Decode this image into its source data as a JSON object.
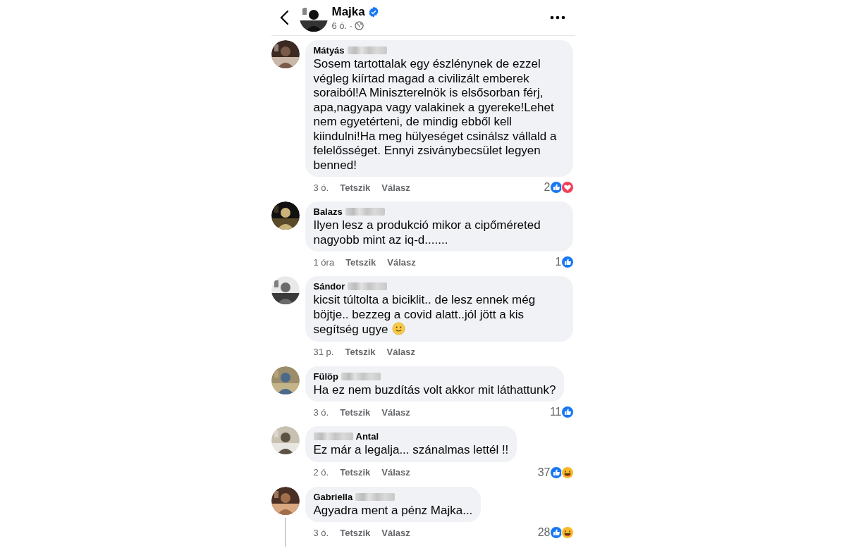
{
  "post": {
    "author": "Majka",
    "verified": true,
    "time": "6 ó. ·"
  },
  "comments": [
    {
      "name_parts": [
        {
          "kind": "name",
          "text": "Mátyás"
        },
        {
          "kind": "blurred"
        }
      ],
      "text": "Sosem tartottalak egy észlénynek de ezzel végleg kiírtad magad a civilizált emberek soraiból!A Miniszterelnök is elsősorban férj, apa,nagyapa vagy valakinek a gyereke!Lehet nem egyetérteni, de mindig ebből kell kiindulni!Ha meg hülyeséget csinálsz vállald a felelősséget. Ennyi zsiványbecsület legyen benned!",
      "time": "3 ó.",
      "like": "Tetszik",
      "reply": "Válasz",
      "count": "2",
      "reactions": [
        {
          "kind": "like"
        },
        {
          "kind": "love"
        }
      ]
    },
    {
      "name_parts": [
        {
          "kind": "name",
          "text": "Balazs"
        },
        {
          "kind": "blurred"
        }
      ],
      "text": "Ilyen lesz a produkció mikor a cipőméreted nagyobb mint az iq-d.......",
      "time": "1 óra",
      "like": "Tetszik",
      "reply": "Válasz",
      "count": "1",
      "reactions": [
        {
          "kind": "like"
        }
      ]
    },
    {
      "name_parts": [
        {
          "kind": "name",
          "text": "Sándor"
        },
        {
          "kind": "blurred"
        }
      ],
      "text": "kicsit túltolta a biciklit.. de lesz ennek még böjtje.. bezzeg a covid alatt..jól jött a kis segítség ugye",
      "smiley": true,
      "time": "31 p.",
      "like": "Tetszik",
      "reply": "Válasz"
    },
    {
      "name_parts": [
        {
          "kind": "name",
          "text": "Fülöp"
        },
        {
          "kind": "blurred"
        }
      ],
      "text": "Ha ez nem buzdítás volt akkor mit láthattunk?",
      "time": "3 ó.",
      "like": "Tetszik",
      "reply": "Válasz",
      "count": "11",
      "reactions": [
        {
          "kind": "like"
        }
      ]
    },
    {
      "name_parts": [
        {
          "kind": "blurred"
        },
        {
          "kind": "name",
          "text": "Antal"
        }
      ],
      "text": "Ez már a legalja... szánalmas lettél !!",
      "time": "2 ó.",
      "like": "Tetszik",
      "reply": "Válasz",
      "count": "37",
      "reactions": [
        {
          "kind": "like"
        },
        {
          "kind": "haha"
        }
      ]
    },
    {
      "name_parts": [
        {
          "kind": "name",
          "text": "Gabriella"
        },
        {
          "kind": "blurred"
        }
      ],
      "text": "Agyadra ment a pénz Majka...",
      "time": "3 ó.",
      "like": "Tetszik",
      "reply": "Válasz",
      "count": "28",
      "reactions": [
        {
          "kind": "like"
        },
        {
          "kind": "haha"
        }
      ],
      "thread": true
    }
  ]
}
